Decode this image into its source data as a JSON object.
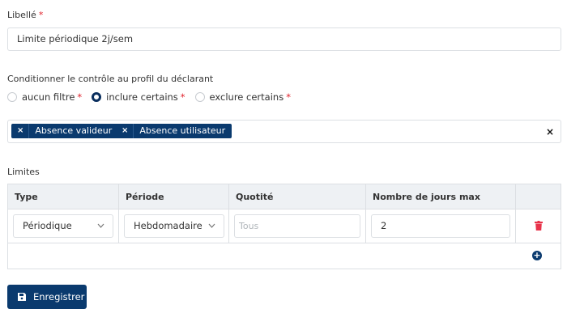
{
  "libelle": {
    "label": "Libellé",
    "required_mark": "*",
    "value": "Limite périodique 2j/sem"
  },
  "condition": {
    "label": "Conditionner le contrôle au profil du déclarant",
    "options": [
      {
        "label": "aucun filtre",
        "required_mark": "*",
        "checked": false
      },
      {
        "label": "inclure certains",
        "required_mark": "*",
        "checked": true
      },
      {
        "label": "exclure certains",
        "required_mark": "*",
        "checked": false
      }
    ],
    "tags": [
      {
        "remove": "×",
        "label": "Absence valideur"
      },
      {
        "remove": "×",
        "label": "Absence utilisateur"
      }
    ],
    "clear": "×"
  },
  "limites": {
    "label": "Limites",
    "headers": [
      "Type",
      "Période",
      "Quotité",
      "Nombre de jours max",
      ""
    ],
    "rows": [
      {
        "type": "Périodique",
        "periode": "Hebdomadaire",
        "quotite_placeholder": "Tous",
        "jours_max": "2"
      }
    ],
    "add_symbol": "+"
  },
  "save_button": {
    "label": "Enregistrer"
  },
  "colors": {
    "primary": "#0a3a6e",
    "required": "#e0202a",
    "delete": "#e8334a",
    "header_bg": "#eef1f4"
  },
  "icons": {
    "delete": "trash-icon",
    "add": "plus-circle-icon",
    "save": "floppy-disk-icon",
    "select": "chevron-down-icon"
  }
}
